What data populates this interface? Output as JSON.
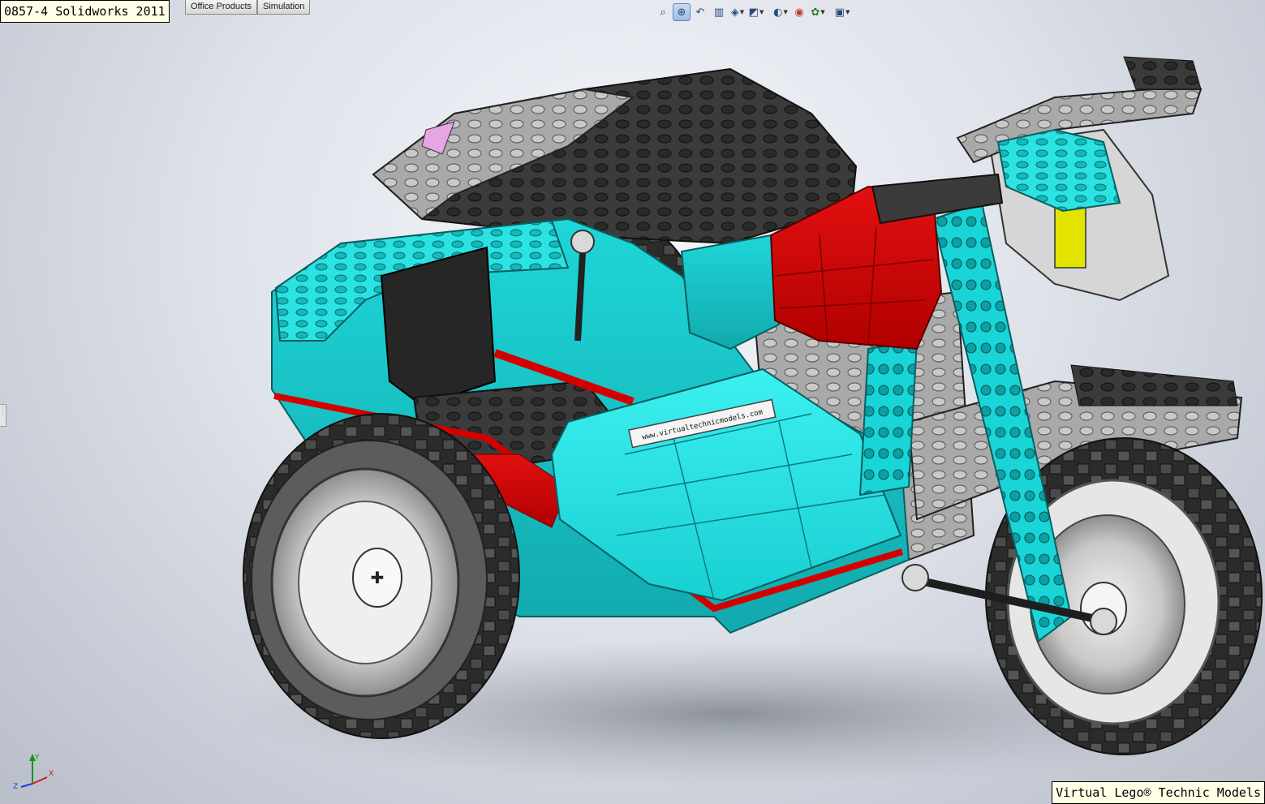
{
  "window": {
    "title": "0857-4 Solidworks 2011"
  },
  "command_manager": {
    "tabs": [
      {
        "label": "Office Products"
      },
      {
        "label": "Simulation"
      }
    ]
  },
  "heads_up_toolbar": {
    "buttons": [
      {
        "icon": "zoom-to-fit-icon",
        "glyph": "⌕",
        "active": false
      },
      {
        "icon": "zoom-to-area-icon",
        "glyph": "⊕",
        "active": true
      },
      {
        "icon": "previous-view-icon",
        "glyph": "↶",
        "active": false
      },
      {
        "icon": "section-view-icon",
        "glyph": "▥",
        "active": false
      },
      {
        "icon": "view-orientation-icon",
        "glyph": "◈",
        "active": false
      },
      {
        "icon": "display-style-icon",
        "glyph": "◩",
        "active": false
      },
      {
        "icon": "hide-show-items-icon",
        "glyph": "◐",
        "active": false
      },
      {
        "icon": "edit-appearance-icon",
        "glyph": "◉",
        "active": false
      },
      {
        "icon": "apply-scene-icon",
        "glyph": "✿",
        "active": false
      },
      {
        "icon": "view-settings-icon",
        "glyph": "▣",
        "active": false
      }
    ]
  },
  "triad": {
    "axes": [
      {
        "label": "Y"
      },
      {
        "label": "Z"
      },
      {
        "label": "X"
      }
    ]
  },
  "watermark": {
    "text": "Virtual Lego® Technic Models"
  },
  "sidecar_decal": {
    "text": "www.virtualtechnicmodels.com"
  },
  "colors": {
    "teal": "#1ee0e0",
    "teal_dark": "#12b5b8",
    "red": "#d40000",
    "dark_grey": "#3a3a3a",
    "light_grey": "#b9b9b9",
    "tire": "#2a2a2a",
    "yellow": "#e6e600"
  }
}
